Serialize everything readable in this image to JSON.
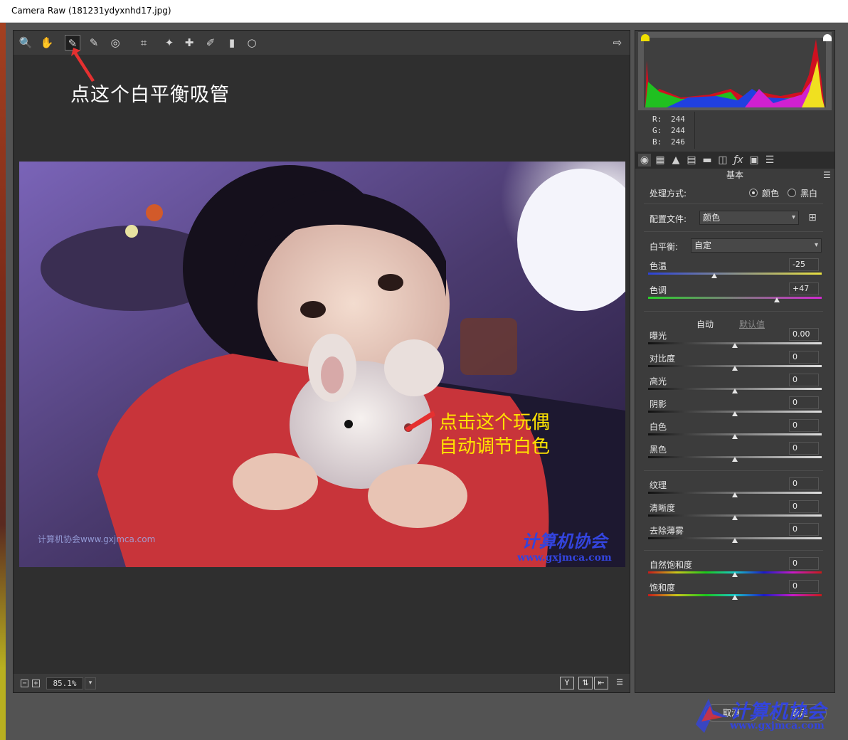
{
  "window": {
    "title": "Camera Raw (181231ydyxnhd17.jpg)"
  },
  "toolbar": {
    "tools": [
      {
        "name": "zoom-tool",
        "icon": "🔍"
      },
      {
        "name": "hand-tool",
        "icon": "✋"
      },
      {
        "name": "white-balance-tool",
        "icon": "✎"
      },
      {
        "name": "color-sampler-tool",
        "icon": "✎"
      },
      {
        "name": "targeted-adjustment-tool",
        "icon": "◎"
      },
      {
        "name": "crop-tool",
        "icon": "⌗"
      },
      {
        "name": "red-eye-tool",
        "icon": "✦"
      },
      {
        "name": "spot-removal-tool",
        "icon": "✚"
      },
      {
        "name": "adjustment-brush-tool",
        "icon": "✐"
      },
      {
        "name": "graduated-filter-tool",
        "icon": "▮"
      },
      {
        "name": "radial-filter-tool",
        "icon": "○"
      }
    ],
    "open_preferences_icon": "⇨"
  },
  "annotations": {
    "top": "点这个白平衡吸管",
    "photo_line1": "点击这个玩偶",
    "photo_line2": "自动调节白色"
  },
  "watermarks": {
    "left": "计算机协会www.gxjmca.com",
    "cn": "计算机协会",
    "url": "www.gxjmca.com"
  },
  "bottom_bar": {
    "zoom_out": "−",
    "zoom_in": "+",
    "zoom_value": "85.1%",
    "view_buttons": [
      "Y",
      "⇅",
      "⇤",
      "☰"
    ]
  },
  "readout": {
    "r_label": "R:",
    "r": "244",
    "g_label": "G:",
    "g": "244",
    "b_label": "B:",
    "b": "246"
  },
  "panel": {
    "section_title": "基本",
    "treatment_label": "处理方式:",
    "treatment_color": "颜色",
    "treatment_bw": "黑白",
    "profile_label": "配置文件:",
    "profile_value": "颜色",
    "wb_label": "白平衡:",
    "wb_value": "自定",
    "auto_label": "自动",
    "default_label": "默认值",
    "sliders": [
      {
        "label": "色温",
        "value": "-25",
        "position": 0.38
      },
      {
        "label": "色调",
        "value": "+47",
        "position": 0.74
      },
      {
        "label": "曝光",
        "value": "0.00",
        "position": 0.5
      },
      {
        "label": "对比度",
        "value": "0",
        "position": 0.5
      },
      {
        "label": "高光",
        "value": "0",
        "position": 0.5
      },
      {
        "label": "阴影",
        "value": "0",
        "position": 0.5
      },
      {
        "label": "白色",
        "value": "0",
        "position": 0.5
      },
      {
        "label": "黑色",
        "value": "0",
        "position": 0.5
      },
      {
        "label": "纹理",
        "value": "0",
        "position": 0.5
      },
      {
        "label": "清晰度",
        "value": "0",
        "position": 0.5
      },
      {
        "label": "去除薄雾",
        "value": "0",
        "position": 0.5
      },
      {
        "label": "自然饱和度",
        "value": "0",
        "position": 0.5
      },
      {
        "label": "饱和度",
        "value": "0",
        "position": 0.5
      }
    ]
  },
  "buttons": {
    "cancel": "取消",
    "done": "确定"
  },
  "colors": {
    "annotation_top": "#ffffff",
    "annotation_photo": "#ffe400",
    "watermark": "#3344dd",
    "arrow": "#e53030"
  }
}
